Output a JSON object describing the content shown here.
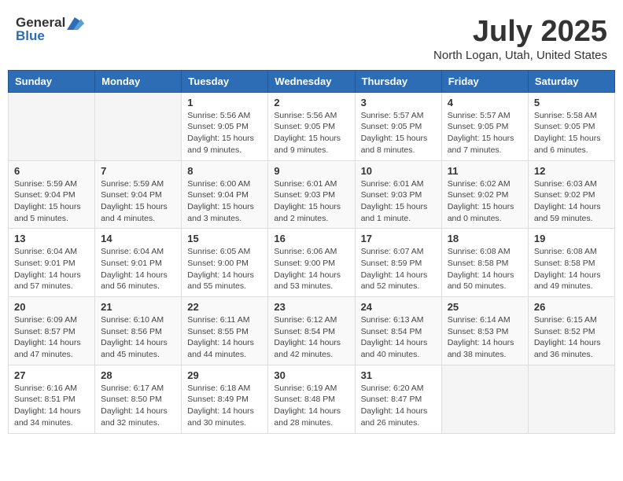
{
  "header": {
    "logo_line1": "General",
    "logo_line2": "Blue",
    "title": "July 2025",
    "subtitle": "North Logan, Utah, United States"
  },
  "days_of_week": [
    "Sunday",
    "Monday",
    "Tuesday",
    "Wednesday",
    "Thursday",
    "Friday",
    "Saturday"
  ],
  "weeks": [
    [
      {
        "day": "",
        "content": ""
      },
      {
        "day": "",
        "content": ""
      },
      {
        "day": "1",
        "content": "Sunrise: 5:56 AM\nSunset: 9:05 PM\nDaylight: 15 hours\nand 9 minutes."
      },
      {
        "day": "2",
        "content": "Sunrise: 5:56 AM\nSunset: 9:05 PM\nDaylight: 15 hours\nand 9 minutes."
      },
      {
        "day": "3",
        "content": "Sunrise: 5:57 AM\nSunset: 9:05 PM\nDaylight: 15 hours\nand 8 minutes."
      },
      {
        "day": "4",
        "content": "Sunrise: 5:57 AM\nSunset: 9:05 PM\nDaylight: 15 hours\nand 7 minutes."
      },
      {
        "day": "5",
        "content": "Sunrise: 5:58 AM\nSunset: 9:05 PM\nDaylight: 15 hours\nand 6 minutes."
      }
    ],
    [
      {
        "day": "6",
        "content": "Sunrise: 5:59 AM\nSunset: 9:04 PM\nDaylight: 15 hours\nand 5 minutes."
      },
      {
        "day": "7",
        "content": "Sunrise: 5:59 AM\nSunset: 9:04 PM\nDaylight: 15 hours\nand 4 minutes."
      },
      {
        "day": "8",
        "content": "Sunrise: 6:00 AM\nSunset: 9:04 PM\nDaylight: 15 hours\nand 3 minutes."
      },
      {
        "day": "9",
        "content": "Sunrise: 6:01 AM\nSunset: 9:03 PM\nDaylight: 15 hours\nand 2 minutes."
      },
      {
        "day": "10",
        "content": "Sunrise: 6:01 AM\nSunset: 9:03 PM\nDaylight: 15 hours\nand 1 minute."
      },
      {
        "day": "11",
        "content": "Sunrise: 6:02 AM\nSunset: 9:02 PM\nDaylight: 15 hours\nand 0 minutes."
      },
      {
        "day": "12",
        "content": "Sunrise: 6:03 AM\nSunset: 9:02 PM\nDaylight: 14 hours\nand 59 minutes."
      }
    ],
    [
      {
        "day": "13",
        "content": "Sunrise: 6:04 AM\nSunset: 9:01 PM\nDaylight: 14 hours\nand 57 minutes."
      },
      {
        "day": "14",
        "content": "Sunrise: 6:04 AM\nSunset: 9:01 PM\nDaylight: 14 hours\nand 56 minutes."
      },
      {
        "day": "15",
        "content": "Sunrise: 6:05 AM\nSunset: 9:00 PM\nDaylight: 14 hours\nand 55 minutes."
      },
      {
        "day": "16",
        "content": "Sunrise: 6:06 AM\nSunset: 9:00 PM\nDaylight: 14 hours\nand 53 minutes."
      },
      {
        "day": "17",
        "content": "Sunrise: 6:07 AM\nSunset: 8:59 PM\nDaylight: 14 hours\nand 52 minutes."
      },
      {
        "day": "18",
        "content": "Sunrise: 6:08 AM\nSunset: 8:58 PM\nDaylight: 14 hours\nand 50 minutes."
      },
      {
        "day": "19",
        "content": "Sunrise: 6:08 AM\nSunset: 8:58 PM\nDaylight: 14 hours\nand 49 minutes."
      }
    ],
    [
      {
        "day": "20",
        "content": "Sunrise: 6:09 AM\nSunset: 8:57 PM\nDaylight: 14 hours\nand 47 minutes."
      },
      {
        "day": "21",
        "content": "Sunrise: 6:10 AM\nSunset: 8:56 PM\nDaylight: 14 hours\nand 45 minutes."
      },
      {
        "day": "22",
        "content": "Sunrise: 6:11 AM\nSunset: 8:55 PM\nDaylight: 14 hours\nand 44 minutes."
      },
      {
        "day": "23",
        "content": "Sunrise: 6:12 AM\nSunset: 8:54 PM\nDaylight: 14 hours\nand 42 minutes."
      },
      {
        "day": "24",
        "content": "Sunrise: 6:13 AM\nSunset: 8:54 PM\nDaylight: 14 hours\nand 40 minutes."
      },
      {
        "day": "25",
        "content": "Sunrise: 6:14 AM\nSunset: 8:53 PM\nDaylight: 14 hours\nand 38 minutes."
      },
      {
        "day": "26",
        "content": "Sunrise: 6:15 AM\nSunset: 8:52 PM\nDaylight: 14 hours\nand 36 minutes."
      }
    ],
    [
      {
        "day": "27",
        "content": "Sunrise: 6:16 AM\nSunset: 8:51 PM\nDaylight: 14 hours\nand 34 minutes."
      },
      {
        "day": "28",
        "content": "Sunrise: 6:17 AM\nSunset: 8:50 PM\nDaylight: 14 hours\nand 32 minutes."
      },
      {
        "day": "29",
        "content": "Sunrise: 6:18 AM\nSunset: 8:49 PM\nDaylight: 14 hours\nand 30 minutes."
      },
      {
        "day": "30",
        "content": "Sunrise: 6:19 AM\nSunset: 8:48 PM\nDaylight: 14 hours\nand 28 minutes."
      },
      {
        "day": "31",
        "content": "Sunrise: 6:20 AM\nSunset: 8:47 PM\nDaylight: 14 hours\nand 26 minutes."
      },
      {
        "day": "",
        "content": ""
      },
      {
        "day": "",
        "content": ""
      }
    ]
  ]
}
